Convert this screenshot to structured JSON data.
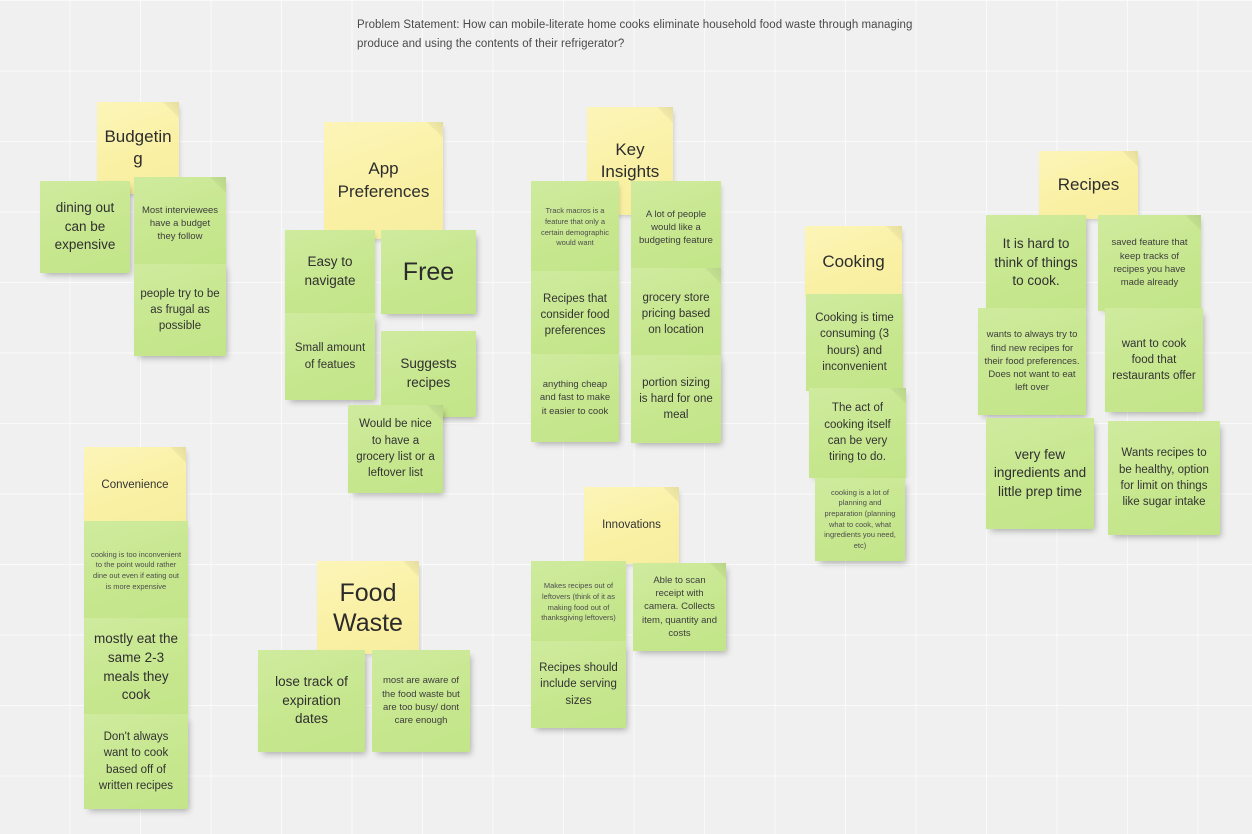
{
  "board": {
    "background_color": "#f0f0f0",
    "grid_color": "#fafafa",
    "header_note_color": "#fbf2ab",
    "sticky_note_color": "#c9e894"
  },
  "problem_statement": "Problem Statement: How can mobile-literate home cooks eliminate household food waste through managing produce and using the contents of their refrigerator?",
  "clusters": {
    "budgeting": {
      "title": "Budgeting",
      "notes": [
        "dining out can be expensive",
        "Most interviewees have a budget they follow",
        "people try to be as frugal as possible"
      ]
    },
    "app_preferences": {
      "title": "App Preferences",
      "notes": [
        "Easy to navigate",
        "Free",
        "Small amount of featues",
        "Suggests recipes",
        "Would be nice to have a grocery list or a leftover list"
      ]
    },
    "key_insights": {
      "title": "Key Insights",
      "notes": [
        "Track macros is a feature that only a certain demographic would want",
        "A lot of people would like a budgeting feature",
        "Recipes that consider food preferences",
        "grocery store pricing based on location",
        "anything cheap and fast to make it easier to cook",
        "portion sizing is hard for one meal"
      ]
    },
    "cooking": {
      "title": "Cooking",
      "notes": [
        "Cooking is time consuming (3 hours)  and inconvenient",
        "The act of cooking itself can be very tiring to do.",
        "cooking is a lot of planning and preparation (planning what to cook, what ingredients you need, etc)"
      ]
    },
    "recipes": {
      "title": "Recipes",
      "notes": [
        "It is hard to think of things to cook.",
        "saved feature that keep tracks of recipes you have made already",
        "wants to always try to find new recipes for their food preferences. Does not want to eat left over",
        "want to cook food that restaurants offer",
        "very few ingredients and little prep time",
        "Wants recipes to be healthy, option for limit on things like sugar intake"
      ]
    },
    "convenience": {
      "title": "Convenience",
      "notes": [
        "cooking is too inconvenient to the point would rather dine out even if eating out is more expensive",
        "mostly eat the same 2-3 meals they cook",
        "Don't always want to cook based off of written recipes"
      ]
    },
    "food_waste": {
      "title": "Food Waste",
      "notes": [
        "lose track of expiration dates",
        "most are aware of the food waste but are too busy/ dont care enough"
      ]
    },
    "innovations": {
      "title": "Innovations",
      "notes": [
        "Makes recipes out of leftovers (think of it as making food out of thanksgiving leftovers)",
        "Able to scan receipt with camera. Collects item, quantity and costs",
        "Recipes should include serving sizes"
      ]
    }
  }
}
